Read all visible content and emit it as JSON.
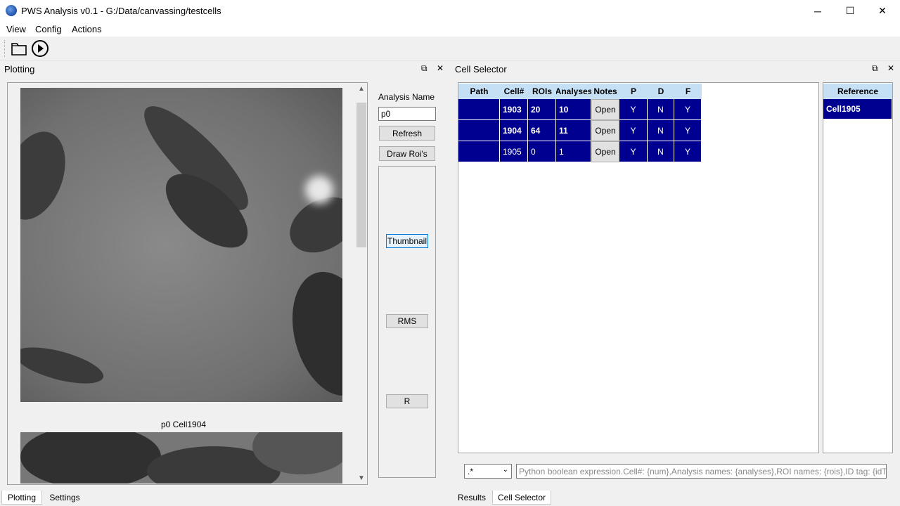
{
  "window": {
    "title": "PWS Analysis v0.1 - G:/Data/canvassing/testcells",
    "minimize": "─",
    "maximize": "☐",
    "close": "✕"
  },
  "menu": [
    "View",
    "Config",
    "Actions"
  ],
  "toolbar": {
    "open_icon": "folder-icon",
    "run_icon": "play-circle-icon"
  },
  "plotting": {
    "dock_title": "Plotting",
    "float_glyph": "⧉",
    "close_glyph": "✕",
    "caption": "p0 Cell1904",
    "scroll_up": "▲",
    "scroll_down": "▼",
    "analysis_name_label": "Analysis Name",
    "analysis_name_value": "p0",
    "refresh": "Refresh",
    "draw_rois": "Draw Roi's",
    "thumbnail": "Thumbnail",
    "rms": "RMS",
    "r": "R"
  },
  "left_tabs": [
    "Plotting",
    "Settings"
  ],
  "cell_selector": {
    "dock_title": "Cell Selector",
    "float_glyph": "⧉",
    "close_glyph": "✕",
    "columns": [
      "Path",
      "Cell#",
      "ROIs",
      "Analyses",
      "Notes",
      "P",
      "D",
      "F"
    ],
    "rows": [
      {
        "path": "",
        "cell": "1903",
        "rois": "20",
        "analyses": "10",
        "notes": "Open",
        "p": "Y",
        "d": "N",
        "f": "Y",
        "bold": true
      },
      {
        "path": "",
        "cell": "1904",
        "rois": "64",
        "analyses": "11",
        "notes": "Open",
        "p": "Y",
        "d": "N",
        "f": "Y",
        "bold": true
      },
      {
        "path": "",
        "cell": "1905",
        "rois": "0",
        "analyses": "1",
        "notes": "Open",
        "p": "Y",
        "d": "N",
        "f": "Y",
        "bold": false
      }
    ],
    "reference_header": "Reference",
    "reference_value": "Cell1905",
    "filter_select": ".*",
    "filter_placeholder": "Python boolean expression.Cell#: {num},Analysis names: {analyses},ROI names: {rois},ID tag: {idTag}.E...",
    "highlight_color": "#000090",
    "header_color": "#c5dff5"
  },
  "right_tabs": [
    "Results",
    "Cell Selector"
  ]
}
